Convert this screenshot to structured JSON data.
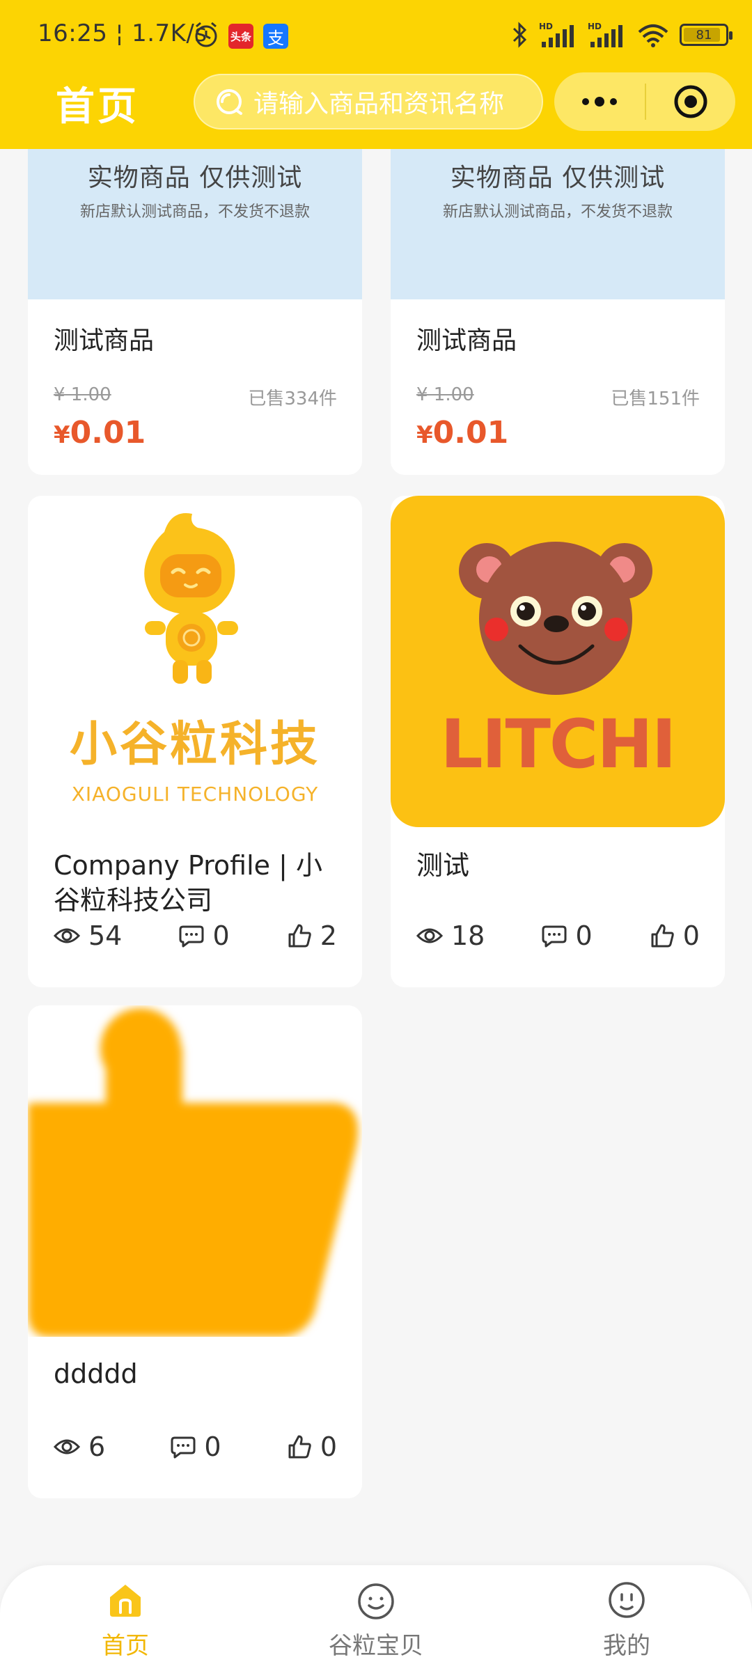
{
  "status_bar": {
    "time": "16:25",
    "speed": "1.7K/s",
    "toutiao_badge": "头条",
    "alipay_badge": "支",
    "signal1": "HD",
    "signal2": "HD",
    "battery": "81"
  },
  "header": {
    "title": "首页",
    "search_placeholder": "请输入商品和资讯名称"
  },
  "goods": [
    {
      "banner_title": "实物商品  仅供测试",
      "banner_subtitle": "新店默认测试商品，不发货不退款",
      "name": "测试商品",
      "original_price": "¥ 1.00",
      "sold": "已售334件",
      "price_symbol": "¥",
      "price": "0.01"
    },
    {
      "banner_title": "实物商品  仅供测试",
      "banner_subtitle": "新店默认测试商品，不发货不退款",
      "name": "测试商品",
      "original_price": "¥ 1.00",
      "sold": "已售151件",
      "price_symbol": "¥",
      "price": "0.01"
    }
  ],
  "posts": [
    {
      "title": "Company Profile | 小谷粒科技公司",
      "logo_cn": "小谷粒科技",
      "logo_en": "XIAOGULI TECHNOLOGY",
      "views": "54",
      "comments": "0",
      "likes": "2"
    },
    {
      "title": "测试",
      "logo_text": "LITCHI",
      "views": "18",
      "comments": "0",
      "likes": "0"
    },
    {
      "title": "ddddd",
      "views": "6",
      "comments": "0",
      "likes": "0"
    }
  ],
  "tabbar": {
    "items": [
      {
        "label": "首页",
        "icon": "home-icon",
        "active": true
      },
      {
        "label": "谷粒宝贝",
        "icon": "smile-face-icon",
        "active": false
      },
      {
        "label": "我的",
        "icon": "user-face-icon",
        "active": false
      }
    ]
  },
  "colors": {
    "brand_yellow": "#fcd403",
    "price_red": "#e8582b",
    "active_tab": "#f2b705"
  }
}
